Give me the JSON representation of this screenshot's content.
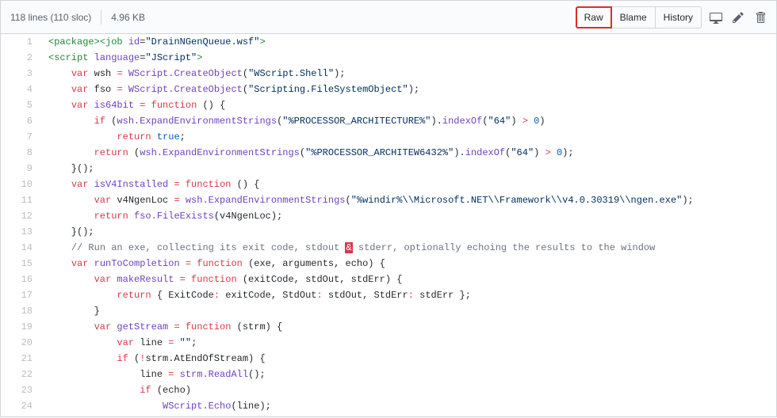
{
  "header": {
    "lines_text": "118 lines (110 sloc)",
    "size_text": "4.96 KB",
    "buttons": {
      "raw": "Raw",
      "blame": "Blame",
      "history": "History"
    }
  },
  "code": {
    "start_line": 1,
    "lines": [
      [
        [
          "tag",
          "<package>"
        ],
        [
          "tag",
          "<job"
        ],
        [
          "id",
          " "
        ],
        [
          "attr",
          "id"
        ],
        [
          "id",
          "="
        ],
        [
          "str",
          "\"DrainNGenQueue.wsf\""
        ],
        [
          "tag",
          ">"
        ]
      ],
      [
        [
          "tag",
          "<script"
        ],
        [
          "id",
          " "
        ],
        [
          "attr",
          "language"
        ],
        [
          "id",
          "="
        ],
        [
          "str",
          "\"JScript\""
        ],
        [
          "tag",
          ">"
        ]
      ],
      [
        [
          "id",
          "    "
        ],
        [
          "kw",
          "var"
        ],
        [
          "id",
          " wsh "
        ],
        [
          "kw",
          "="
        ],
        [
          "id",
          " "
        ],
        [
          "fn",
          "WScript.CreateObject"
        ],
        [
          "id",
          "("
        ],
        [
          "str",
          "\"WScript.Shell\""
        ],
        [
          "id",
          ");"
        ]
      ],
      [
        [
          "id",
          "    "
        ],
        [
          "kw",
          "var"
        ],
        [
          "id",
          " fso "
        ],
        [
          "kw",
          "="
        ],
        [
          "id",
          " "
        ],
        [
          "fn",
          "WScript.CreateObject"
        ],
        [
          "id",
          "("
        ],
        [
          "str",
          "\"Scripting.FileSystemObject\""
        ],
        [
          "id",
          ");"
        ]
      ],
      [
        [
          "id",
          "    "
        ],
        [
          "kw",
          "var"
        ],
        [
          "id",
          " "
        ],
        [
          "fn",
          "is64bit"
        ],
        [
          "id",
          " "
        ],
        [
          "kw",
          "="
        ],
        [
          "id",
          " "
        ],
        [
          "kw",
          "function"
        ],
        [
          "id",
          " () {"
        ]
      ],
      [
        [
          "id",
          "        "
        ],
        [
          "kw",
          "if"
        ],
        [
          "id",
          " ("
        ],
        [
          "fn",
          "wsh.ExpandEnvironmentStrings"
        ],
        [
          "id",
          "("
        ],
        [
          "str",
          "\"%PROCESSOR_ARCHITECTURE%\""
        ],
        [
          "id",
          ")."
        ],
        [
          "fn",
          "indexOf"
        ],
        [
          "id",
          "("
        ],
        [
          "str",
          "\"64\""
        ],
        [
          "id",
          ") "
        ],
        [
          "kw",
          ">"
        ],
        [
          "id",
          " "
        ],
        [
          "num",
          "0"
        ],
        [
          "id",
          ")"
        ]
      ],
      [
        [
          "id",
          "            "
        ],
        [
          "kw",
          "return"
        ],
        [
          "id",
          " "
        ],
        [
          "num",
          "true"
        ],
        [
          "id",
          ";"
        ]
      ],
      [
        [
          "id",
          "        "
        ],
        [
          "kw",
          "return"
        ],
        [
          "id",
          " ("
        ],
        [
          "fn",
          "wsh.ExpandEnvironmentStrings"
        ],
        [
          "id",
          "("
        ],
        [
          "str",
          "\"%PROCESSOR_ARCHITEW6432%\""
        ],
        [
          "id",
          ")."
        ],
        [
          "fn",
          "indexOf"
        ],
        [
          "id",
          "("
        ],
        [
          "str",
          "\"64\""
        ],
        [
          "id",
          ") "
        ],
        [
          "kw",
          ">"
        ],
        [
          "id",
          " "
        ],
        [
          "num",
          "0"
        ],
        [
          "id",
          ");"
        ]
      ],
      [
        [
          "id",
          "    }();"
        ]
      ],
      [
        [
          "id",
          "    "
        ],
        [
          "kw",
          "var"
        ],
        [
          "id",
          " "
        ],
        [
          "fn",
          "isV4Installed"
        ],
        [
          "id",
          " "
        ],
        [
          "kw",
          "="
        ],
        [
          "id",
          " "
        ],
        [
          "kw",
          "function"
        ],
        [
          "id",
          " () {"
        ]
      ],
      [
        [
          "id",
          "        "
        ],
        [
          "kw",
          "var"
        ],
        [
          "id",
          " v4NgenLoc "
        ],
        [
          "kw",
          "="
        ],
        [
          "id",
          " "
        ],
        [
          "fn",
          "wsh.ExpandEnvironmentStrings"
        ],
        [
          "id",
          "("
        ],
        [
          "str",
          "\"%windir%\\\\Microsoft.NET\\\\Framework\\\\v4.0.30319\\\\ngen.exe\""
        ],
        [
          "id",
          ");"
        ]
      ],
      [
        [
          "id",
          "        "
        ],
        [
          "kw",
          "return"
        ],
        [
          "id",
          " "
        ],
        [
          "fn",
          "fso.FileExists"
        ],
        [
          "id",
          "(v4NgenLoc);"
        ]
      ],
      [
        [
          "id",
          "    }();"
        ]
      ],
      [
        [
          "id",
          "    "
        ],
        [
          "com",
          "// Run an exe, collecting its exit code, stdout "
        ],
        [
          "mark",
          "&"
        ],
        [
          "com",
          " stderr, optionally echoing the results to the window"
        ]
      ],
      [
        [
          "id",
          "    "
        ],
        [
          "kw",
          "var"
        ],
        [
          "id",
          " "
        ],
        [
          "fn",
          "runToCompletion"
        ],
        [
          "id",
          " "
        ],
        [
          "kw",
          "="
        ],
        [
          "id",
          " "
        ],
        [
          "kw",
          "function"
        ],
        [
          "id",
          " (exe, arguments, echo) {"
        ]
      ],
      [
        [
          "id",
          "        "
        ],
        [
          "kw",
          "var"
        ],
        [
          "id",
          " "
        ],
        [
          "fn",
          "makeResult"
        ],
        [
          "id",
          " "
        ],
        [
          "kw",
          "="
        ],
        [
          "id",
          " "
        ],
        [
          "kw",
          "function"
        ],
        [
          "id",
          " (exitCode, stdOut, stdErr) {"
        ]
      ],
      [
        [
          "id",
          "            "
        ],
        [
          "kw",
          "return"
        ],
        [
          "id",
          " { ExitCode"
        ],
        [
          "kw",
          ":"
        ],
        [
          "id",
          " exitCode, StdOut"
        ],
        [
          "kw",
          ":"
        ],
        [
          "id",
          " stdOut, StdErr"
        ],
        [
          "kw",
          ":"
        ],
        [
          "id",
          " stdErr };"
        ]
      ],
      [
        [
          "id",
          "        }"
        ]
      ],
      [
        [
          "id",
          "        "
        ],
        [
          "kw",
          "var"
        ],
        [
          "id",
          " "
        ],
        [
          "fn",
          "getStream"
        ],
        [
          "id",
          " "
        ],
        [
          "kw",
          "="
        ],
        [
          "id",
          " "
        ],
        [
          "kw",
          "function"
        ],
        [
          "id",
          " (strm) {"
        ]
      ],
      [
        [
          "id",
          "            "
        ],
        [
          "kw",
          "var"
        ],
        [
          "id",
          " line "
        ],
        [
          "kw",
          "="
        ],
        [
          "id",
          " "
        ],
        [
          "str",
          "\"\""
        ],
        [
          "id",
          ";"
        ]
      ],
      [
        [
          "id",
          "            "
        ],
        [
          "kw",
          "if"
        ],
        [
          "id",
          " ("
        ],
        [
          "kw",
          "!"
        ],
        [
          "id",
          "strm.AtEndOfStream) {"
        ]
      ],
      [
        [
          "id",
          "                line "
        ],
        [
          "kw",
          "="
        ],
        [
          "id",
          " "
        ],
        [
          "fn",
          "strm.ReadAll"
        ],
        [
          "id",
          "();"
        ]
      ],
      [
        [
          "id",
          "                "
        ],
        [
          "kw",
          "if"
        ],
        [
          "id",
          " (echo)"
        ]
      ],
      [
        [
          "id",
          "                    "
        ],
        [
          "fn",
          "WScript.Echo"
        ],
        [
          "id",
          "(line);"
        ]
      ]
    ]
  }
}
